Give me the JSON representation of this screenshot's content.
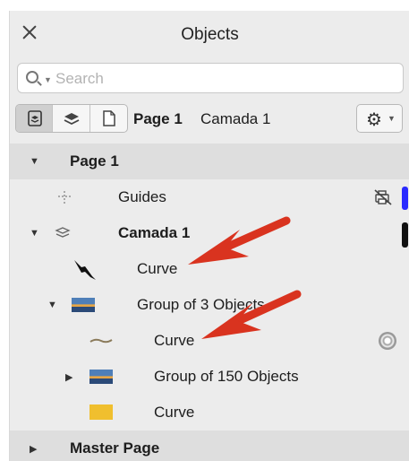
{
  "panel": {
    "title": "Objects",
    "search_placeholder": "Search"
  },
  "toolbar": {
    "current_page": "Page 1",
    "current_layer": "Camada 1",
    "view_icons": [
      "layers-view-icon",
      "stack-icon",
      "page-icon"
    ],
    "options_icon": "gear-icon"
  },
  "tree": {
    "page1": "Page 1",
    "guides": "Guides",
    "layer": "Camada 1",
    "curve_bird": "Curve",
    "group3": "Group of 3 Objects",
    "curve_inner": "Curve",
    "group150": "Group of 150 Objects",
    "curve_yellow": "Curve",
    "master_page": "Master Page"
  },
  "colors": {
    "guides_layer": "#2a2aff",
    "layer_color": "#111111",
    "annotation_arrow": "#d9331f",
    "yellow_swatch": "#f0bf2e"
  }
}
